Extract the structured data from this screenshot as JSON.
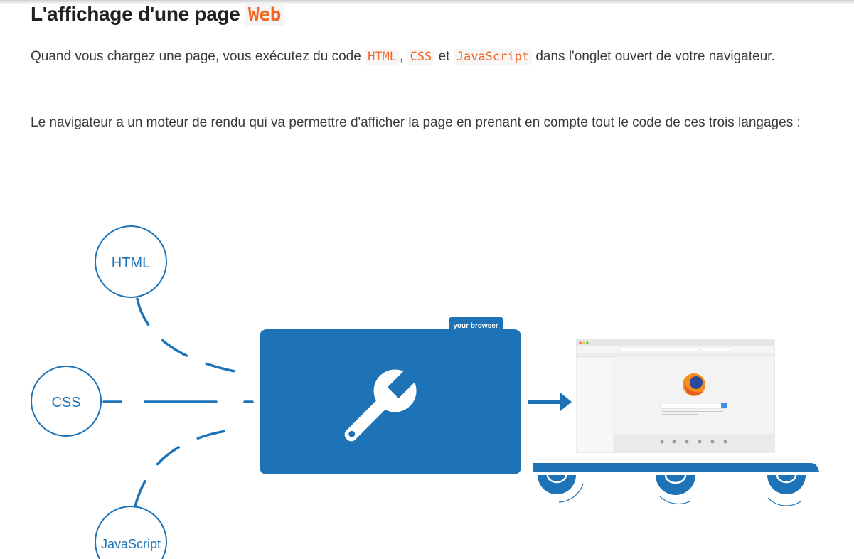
{
  "heading": {
    "text": "L'affichage d'une page",
    "highlight": "Web"
  },
  "paragraph1": {
    "before": "Quand vous chargez une page, vous exécutez du code",
    "code1": "HTML",
    "sep1": ",",
    "code2": "CSS",
    "sep2": "et",
    "code3": "JavaScript",
    "after": "dans l'onglet ouvert de votre navigateur."
  },
  "paragraph2": {
    "text": "Le navigateur a un moteur de rendu qui va permettre d'afficher la page en prenant en compte tout le code de ces trois langages :"
  },
  "diagram": {
    "html_label": "HTML",
    "css_label": "CSS",
    "js_label": "JavaScript",
    "browser_tab_label": "your browser",
    "colors": {
      "blue": "#1d73b5",
      "accent_orange": "#f26522"
    },
    "icons": [
      "wrench-icon",
      "arrow-right-icon",
      "firefox-logo-icon",
      "gear-icon"
    ]
  }
}
